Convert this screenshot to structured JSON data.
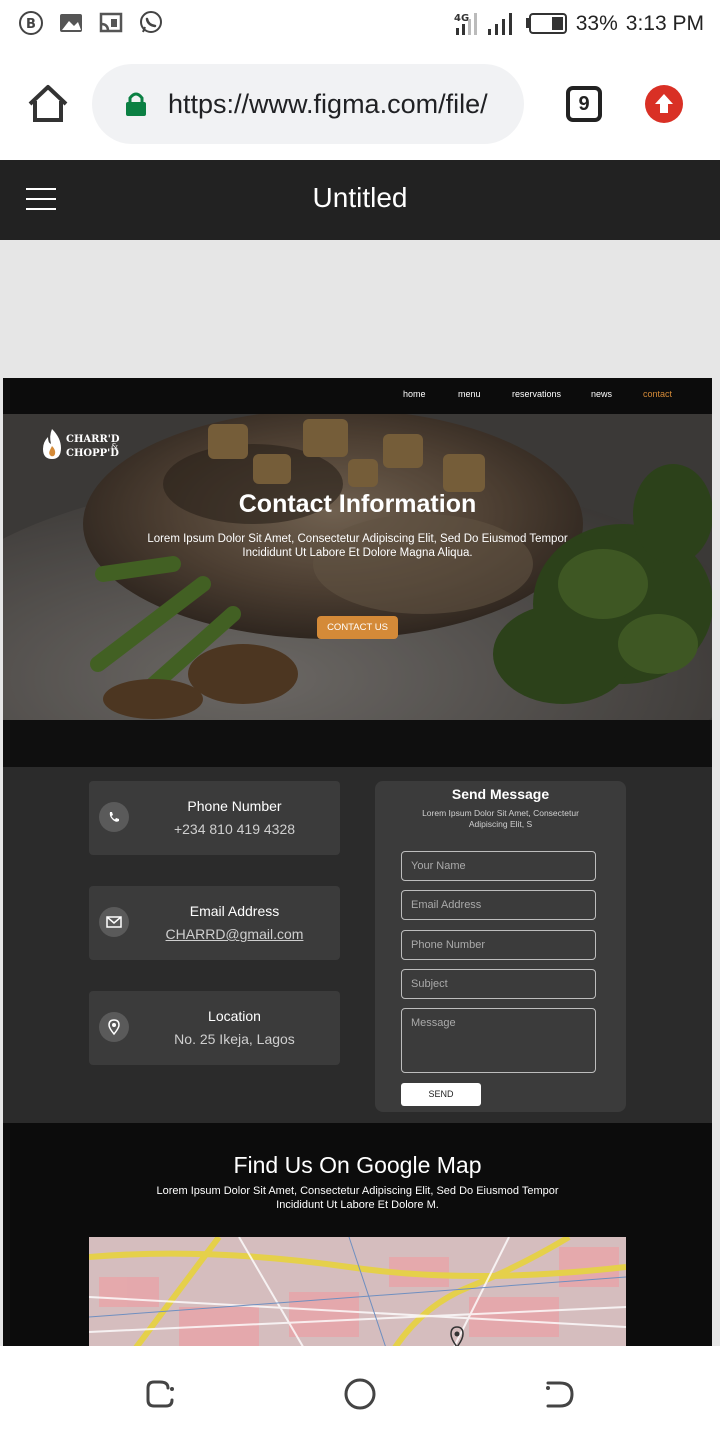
{
  "status_bar": {
    "network": "4G",
    "battery": "33%",
    "time": "3:13 PM"
  },
  "browser": {
    "url": "https://www.figma.com/file/",
    "tab_count": "9"
  },
  "app_bar": {
    "title": "Untitled"
  },
  "site": {
    "brand_line1": "CHARR'D",
    "brand_line2": "CHOPP'D",
    "brand_amp": "&",
    "nav": [
      "home",
      "menu",
      "reservations",
      "news",
      "contact"
    ],
    "active_nav": "contact",
    "hero": {
      "title": "Contact Information",
      "text": "Lorem Ipsum Dolor Sit Amet, Consectetur Adipiscing Elit, Sed Do Eiusmod Tempor Incididunt Ut Labore Et Dolore Magna Aliqua.",
      "button": "CONTACT US"
    },
    "contact": {
      "phone_title": "Phone Number",
      "phone_value": "+234 810 419 4328",
      "email_title": "Email Address",
      "email_value": "CHARRD@gmail.com",
      "location_title": "Location",
      "location_value": "No. 25 Ikeja, Lagos"
    },
    "message_form": {
      "title": "Send Message",
      "subtitle": "Lorem Ipsum Dolor Sit Amet, Consectetur Adipiscing Elit, S",
      "name_placeholder": "Your Name",
      "email_placeholder": "Email Address",
      "phone_placeholder": "Phone Number",
      "subject_placeholder": "Subject",
      "message_placeholder": "Message",
      "send_label": "SEND"
    },
    "map_section": {
      "title": "Find Us On Google Map",
      "text": "Lorem Ipsum Dolor Sit Amet, Consectetur Adipiscing Elit, Sed Do Eiusmod Tempor Incididunt Ut Labore Et Dolore M."
    }
  },
  "colors": {
    "accent": "#d48a38",
    "app_bar": "#222222",
    "contact_bg": "#2b2b2b",
    "card_bg": "#3b3b3b"
  }
}
